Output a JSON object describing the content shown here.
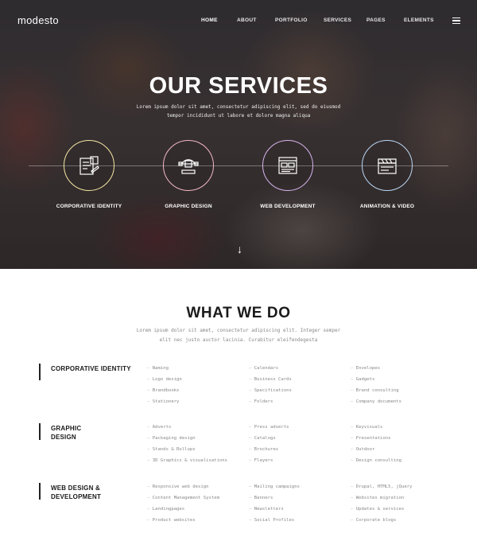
{
  "nav": {
    "logo": "modesto",
    "items": [
      "HOME",
      "ABOUT",
      "PORTFOLIO",
      "SERVICES",
      "PAGES",
      "ELEMENTS"
    ],
    "active": "HOME"
  },
  "hero": {
    "title": "OUR SERVICES",
    "subtitle": "Lorem ipsum dolor sit amet, consectetur adipiscing elit, sed do eiusmod tempor incididunt ut labore et dolore magna aliqua",
    "services": [
      {
        "label": "CORPORATIVE IDENTITY",
        "icon": "identity-document-icon",
        "color": "#f3e6a2"
      },
      {
        "label": "GRAPHIC DESIGN",
        "icon": "vector-bezier-icon",
        "color": "#f2b8c4"
      },
      {
        "label": "WEB DEVELOPMENT",
        "icon": "browser-layout-icon",
        "color": "#d5b4ec"
      },
      {
        "label": "ANIMATION & VIDEO",
        "icon": "clapperboard-icon",
        "color": "#b9d6f3"
      }
    ],
    "scroll_icon": "↓"
  },
  "whatwedo": {
    "title": "WHAT WE DO",
    "subtitle": "Lorem ipsum dolor sit amet, consectetur adipiscing elit. Integer semper elit nec justo auctor lacinia. Curabitur eleifendegesta",
    "categories": [
      {
        "name": "CORPORATIVE IDENTITY",
        "columns": [
          [
            "Naming",
            "Logo design",
            "Brandbooks",
            "Stationery"
          ],
          [
            "Calendars",
            "Business Cards",
            "Specifications",
            "Folders"
          ],
          [
            "Envelopes",
            "Gadgets",
            "Brand consulting",
            "Company documents"
          ]
        ]
      },
      {
        "name": "GRAPHIC DESIGN",
        "columns": [
          [
            "Adverts",
            "Packaging design",
            "Stands & Rollups",
            "3D Graphics & visualisations"
          ],
          [
            "Press adverts",
            "Catalogs",
            "Brochures",
            "Flayers"
          ],
          [
            "Keyvisuals",
            "Presentations",
            "Outdoor",
            "Design consulting"
          ]
        ]
      },
      {
        "name": "WEB DESIGN & DEVELOPMENT",
        "columns": [
          [
            "Responsive web design",
            "Content Management System",
            "Landingpages",
            "Product websites"
          ],
          [
            "Mailing campaigns",
            "Banners",
            "Newsletters",
            "Social Profiles"
          ],
          [
            "Drupal, HTML5, jQuery",
            "Websites migration",
            "Updates & services",
            "Corporate blogs"
          ]
        ]
      }
    ]
  }
}
